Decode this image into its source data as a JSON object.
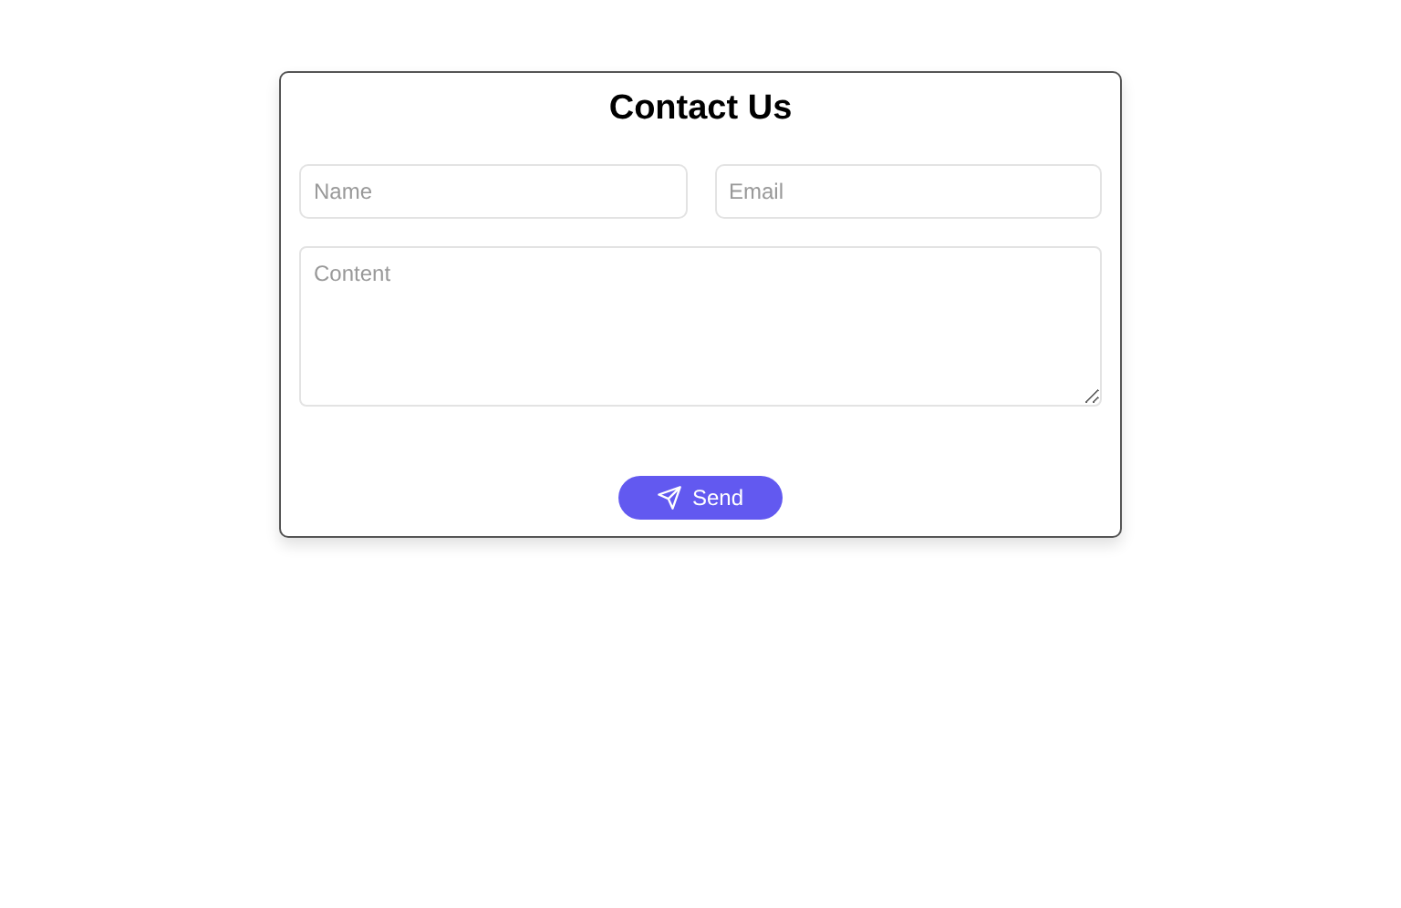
{
  "title": "Contact Us",
  "fields": [
    {
      "placeholder": "Name"
    },
    {
      "placeholder": "Email"
    }
  ],
  "message": {
    "placeholder": "Content"
  },
  "submit": {
    "label": "Send"
  }
}
